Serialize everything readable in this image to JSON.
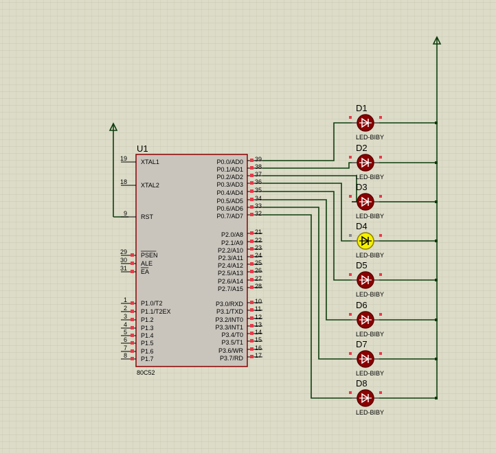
{
  "chip": {
    "ref": "U1",
    "part": "80C52",
    "left_pins": [
      {
        "num": "19",
        "label": "XTAL1"
      },
      {
        "num": "18",
        "label": "XTAL2"
      },
      {
        "num": "9",
        "label": "RST"
      },
      {
        "num": "29",
        "label": "PSEN"
      },
      {
        "num": "30",
        "label": "ALE"
      },
      {
        "num": "31",
        "label": "EA"
      },
      {
        "num": "1",
        "label": "P1.0/T2"
      },
      {
        "num": "2",
        "label": "P1.1/T2EX"
      },
      {
        "num": "3",
        "label": "P1.2"
      },
      {
        "num": "4",
        "label": "P1.3"
      },
      {
        "num": "5",
        "label": "P1.4"
      },
      {
        "num": "6",
        "label": "P1.5"
      },
      {
        "num": "7",
        "label": "P1.6"
      },
      {
        "num": "8",
        "label": "P1.7"
      }
    ],
    "right_pins": [
      {
        "num": "39",
        "label": "P0.0/AD0"
      },
      {
        "num": "38",
        "label": "P0.1/AD1"
      },
      {
        "num": "37",
        "label": "P0.2/AD2"
      },
      {
        "num": "36",
        "label": "P0.3/AD3"
      },
      {
        "num": "35",
        "label": "P0.4/AD4"
      },
      {
        "num": "34",
        "label": "P0.5/AD5"
      },
      {
        "num": "33",
        "label": "P0.6/AD6"
      },
      {
        "num": "32",
        "label": "P0.7/AD7"
      },
      {
        "num": "21",
        "label": "P2.0/A8"
      },
      {
        "num": "22",
        "label": "P2.1/A9"
      },
      {
        "num": "23",
        "label": "P2.2/A10"
      },
      {
        "num": "24",
        "label": "P2.3/A11"
      },
      {
        "num": "25",
        "label": "P2.4/A12"
      },
      {
        "num": "26",
        "label": "P2.5/A13"
      },
      {
        "num": "27",
        "label": "P2.6/A14"
      },
      {
        "num": "28",
        "label": "P2.7/A15"
      },
      {
        "num": "10",
        "label": "P3.0/RXD"
      },
      {
        "num": "11",
        "label": "P3.1/TXD"
      },
      {
        "num": "12",
        "label": "P3.2/INT0"
      },
      {
        "num": "13",
        "label": "P3.3/INT1"
      },
      {
        "num": "14",
        "label": "P3.4/T0"
      },
      {
        "num": "15",
        "label": "P3.5/T1"
      },
      {
        "num": "16",
        "label": "P3.6/WR"
      },
      {
        "num": "17",
        "label": "P3.7/RD"
      }
    ]
  },
  "leds": [
    {
      "ref": "D1",
      "part": "LED-BIBY",
      "lit": false
    },
    {
      "ref": "D2",
      "part": "LED-BIBY",
      "lit": false
    },
    {
      "ref": "D3",
      "part": "LED-BIBY",
      "lit": false
    },
    {
      "ref": "D4",
      "part": "LED-BIBY",
      "lit": true
    },
    {
      "ref": "D5",
      "part": "LED-BIBY",
      "lit": false
    },
    {
      "ref": "D6",
      "part": "LED-BIBY",
      "lit": false
    },
    {
      "ref": "D7",
      "part": "LED-BIBY",
      "lit": false
    },
    {
      "ref": "D8",
      "part": "LED-BIBY",
      "lit": false
    }
  ],
  "colors": {
    "background": "#dcdcc8",
    "grid": "#c4c4ae",
    "wire": "#0b3d0b",
    "chip_fill": "#c9c5bd",
    "chip_border": "#8b0000",
    "led_off": "#8b0000",
    "led_on": "#f5f000",
    "pin_marker": "#e8394a"
  },
  "icons": {
    "power_terminal": "arrow-up-icon",
    "led": "led-diode-icon"
  }
}
